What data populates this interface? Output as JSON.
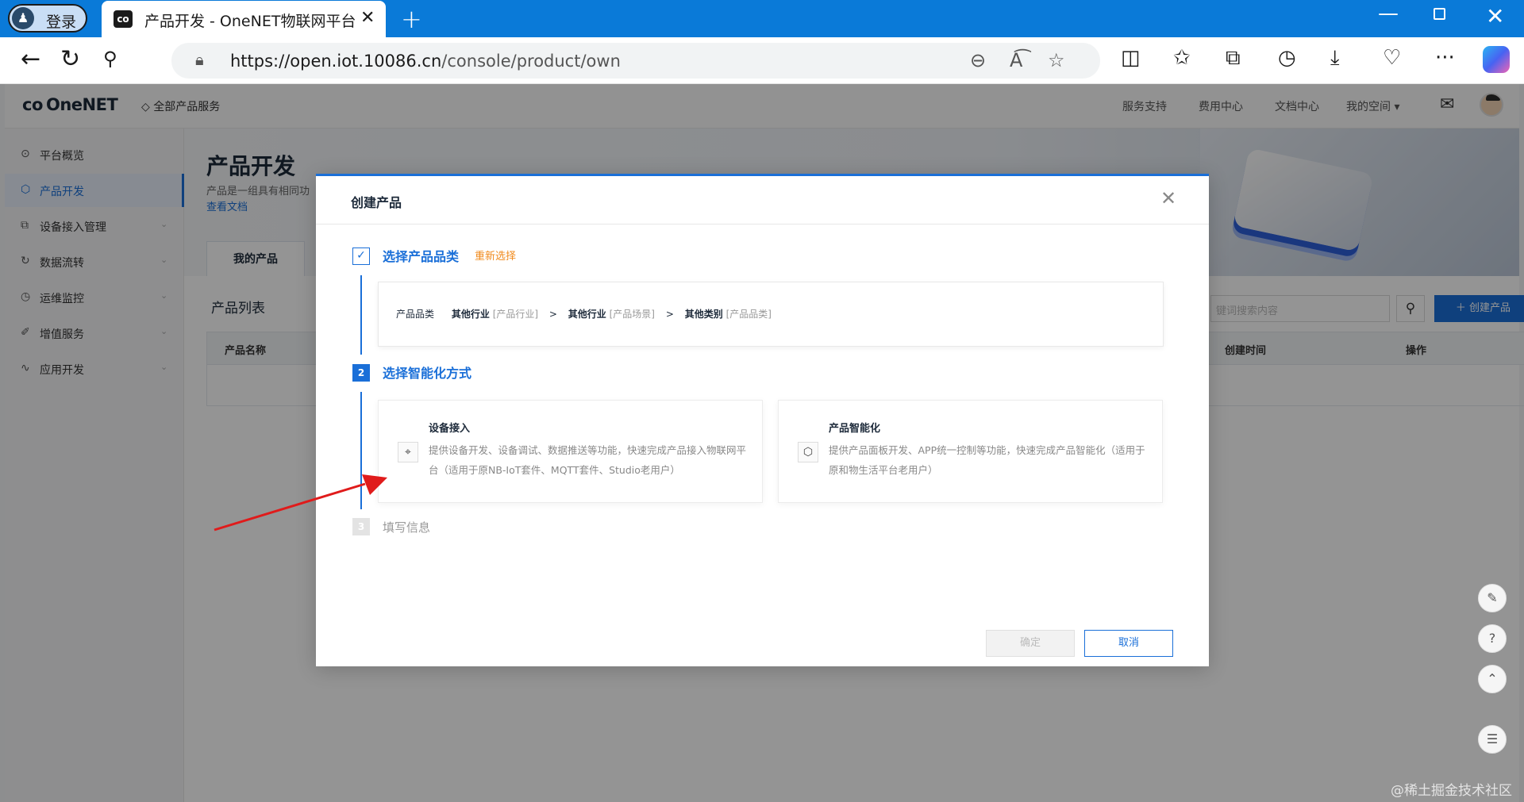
{
  "browser": {
    "profile_label": "登录",
    "tab_title": "产品开发 - OneNET物联网平台",
    "tab_favicon": "co",
    "url_host": "https://open.iot.10086.cn",
    "url_path": "/console/product/own",
    "icons": [
      "back-arrow-icon",
      "reload-icon",
      "search-icon",
      "lock-icon",
      "zoom-out-icon",
      "read-aloud-icon",
      "favorite-star-icon",
      "split-screen-icon",
      "favorites-icon",
      "collections-icon",
      "history-icon",
      "download-icon",
      "performance-icon",
      "more-icon",
      "copilot-icon"
    ]
  },
  "topnav": {
    "logo": "OneNET",
    "all_services": "全部产品服务",
    "links": [
      "服务支持",
      "费用中心",
      "文档中心",
      "我的空间 ▾"
    ]
  },
  "sidebar": {
    "items": [
      {
        "label": "平台概览",
        "icon": "⊙"
      },
      {
        "label": "产品开发",
        "icon": "⬡"
      },
      {
        "label": "设备接入管理",
        "icon": "⧉"
      },
      {
        "label": "数据流转",
        "icon": "↻"
      },
      {
        "label": "运维监控",
        "icon": "◷"
      },
      {
        "label": "增值服务",
        "icon": "✐"
      },
      {
        "label": "应用开发",
        "icon": "∿"
      }
    ]
  },
  "content": {
    "title": "产品开发",
    "desc": "产品是一组具有相同功",
    "doc_link": "查看文档",
    "tab_label": "我的产品",
    "list_title": "产品列表",
    "search_placeholder": "键词搜索内容",
    "create_button": "＋  创建产品",
    "columns": [
      "产品名称",
      "创建时间",
      "操作"
    ]
  },
  "modal": {
    "title": "创建产品",
    "step1": {
      "title": "选择产品品类",
      "reselect": "重新选择"
    },
    "category": {
      "label": "产品品类",
      "v1": "其他行业",
      "t1": "[产品行业]",
      "v2": "其他行业",
      "t2": "[产品场景]",
      "v3": "其他类别",
      "t3": "[产品品类]"
    },
    "step2": {
      "number": "2",
      "title": "选择智能化方式",
      "cards": [
        {
          "title": "设备接入",
          "desc": "提供设备开发、设备调试、数据推送等功能，快速完成产品接入物联网平台（适用于原NB-IoT套件、MQTT套件、Studio老用户）"
        },
        {
          "title": "产品智能化",
          "desc": "提供产品面板开发、APP统一控制等功能，快速完成产品智能化（适用于原和物生活平台老用户）"
        }
      ]
    },
    "step3": {
      "number": "3",
      "title": "填写信息"
    },
    "confirm": "确定",
    "cancel": "取消"
  },
  "watermark": "@稀土掘金技术社区",
  "colors": {
    "accent": "#1a6fd8",
    "browser_bar": "#0a7ad8",
    "warning": "#f08a1c",
    "arrow": "#e01b1b"
  }
}
